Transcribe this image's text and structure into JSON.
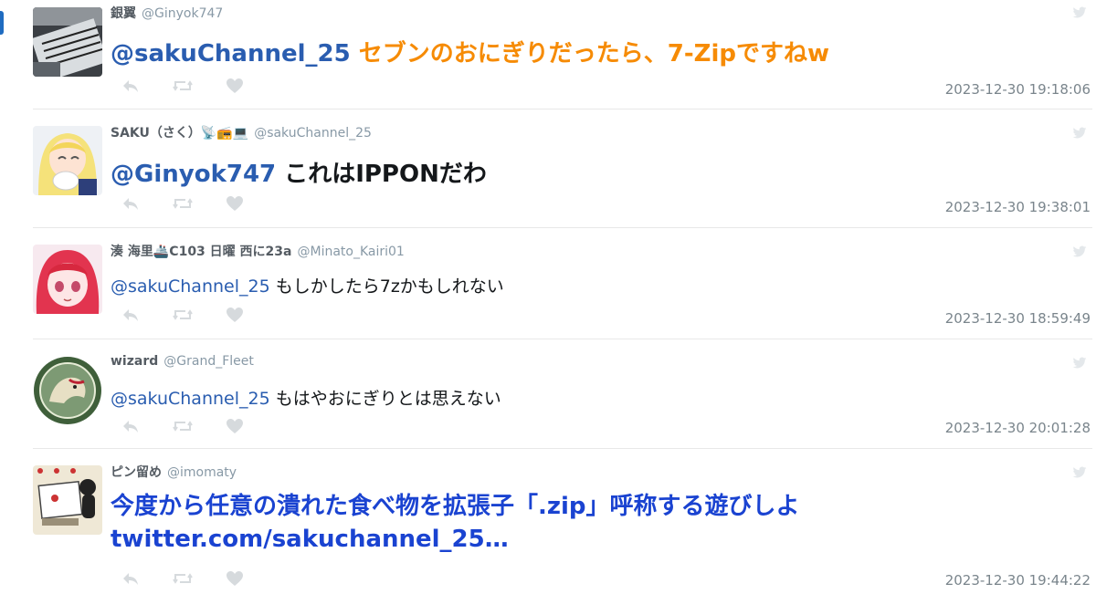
{
  "tweets": [
    {
      "name": "銀翼",
      "handle": "@Ginyok747",
      "mention": "@sakuChannel_25",
      "text": " セブンのおにぎりだったら、7-Zipですねw",
      "timestamp": "2023-12-30 19:18:06"
    },
    {
      "name": "SAKU（さく）📡📻💻",
      "handle": "@sakuChannel_25",
      "mention": "@Ginyok747",
      "text": " これはIPPONだわ",
      "timestamp": "2023-12-30 19:38:01"
    },
    {
      "name": "湊 海里🚢C103 日曜 西に23a",
      "handle": "@Minato_Kairi01",
      "mention": "@sakuChannel_25",
      "text": " もしかしたら7zかもしれない",
      "timestamp": "2023-12-30 18:59:49"
    },
    {
      "name": "wizard",
      "handle": "@Grand_Fleet",
      "mention": "@sakuChannel_25",
      "text": " もはやおにぎりとは思えない",
      "timestamp": "2023-12-30 20:01:28"
    },
    {
      "name": "ピン留め",
      "handle": "@imomaty",
      "text": "今度から任意の潰れた食べ物を拡張子「.zip」呼称する遊びしよ",
      "link": "twitter.com/sakuchannel_25…",
      "timestamp": "2023-12-30 19:44:22"
    }
  ],
  "icons": [
    "reply-icon",
    "retweet-icon",
    "like-icon",
    "twitter-bird-icon"
  ],
  "colors": {
    "mention_blue": "#2a5db0",
    "orange_text": "#f68b05",
    "link_blue": "#1a43d1",
    "meta_gray": "#8899a6",
    "action_gray": "#d6dadd"
  }
}
